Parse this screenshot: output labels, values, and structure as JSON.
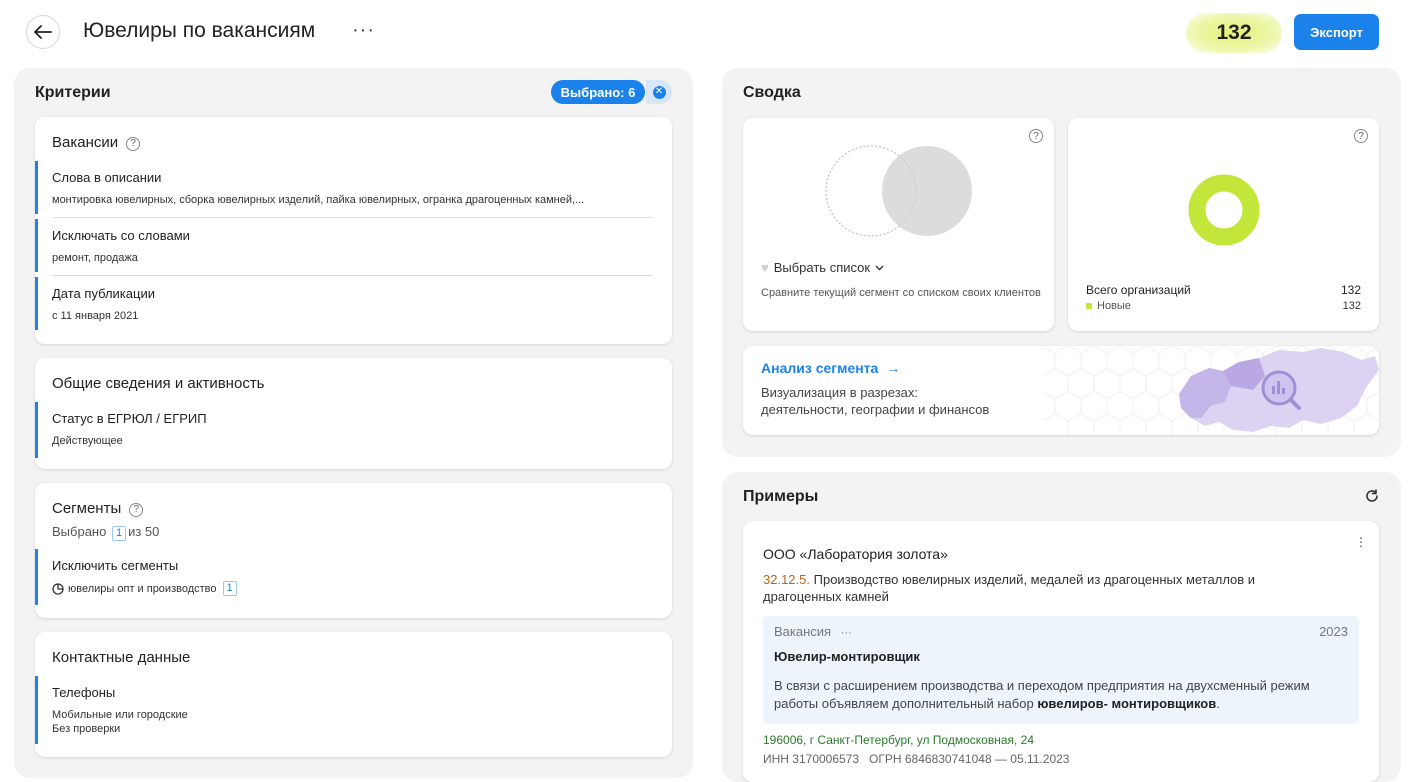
{
  "header": {
    "title": "Ювелиры по вакансиям",
    "more": "···",
    "count": "132",
    "export_label": "Экспорт"
  },
  "criteria": {
    "title": "Критерии",
    "selected_label": "Выбрано: 6",
    "vacancies": {
      "title": "Вакансии",
      "help": "?",
      "items": [
        {
          "name": "Слова в описании",
          "value": "монтировка ювелирных, сборка ювелирных изделий, пайка ювелирных, огранка драгоценных камней,..."
        },
        {
          "name": "Исключать со словами",
          "value": "ремонт, продажа"
        },
        {
          "name": "Дата публикации",
          "value": "с 11 января 2021"
        }
      ]
    },
    "general": {
      "title": "Общие сведения и активность",
      "items": [
        {
          "name": "Статус в ЕГРЮЛ / ЕГРИП",
          "value": "Действующее"
        }
      ]
    },
    "segments": {
      "title": "Сегменты",
      "help": "?",
      "selected_prefix": "Выбрано",
      "selected_count": "1",
      "selected_suffix": "из 50",
      "exclude_name": "Исключить сегменты",
      "exclude_value": "ювелиры опт и производство",
      "exclude_count": "1"
    },
    "contacts": {
      "title": "Контактные данные",
      "phones_name": "Телефоны",
      "phones_line1": "Мобильные или городские",
      "phones_line2": "Без проверки"
    }
  },
  "summary": {
    "title": "Сводка",
    "help": "?",
    "choose_list": "Выбрать список",
    "compare_hint": "Сравните текущий сегмент со списком своих клиентов",
    "total_label": "Всего организаций",
    "total_value": "132",
    "new_label": "Новые",
    "new_value": "132",
    "new_fraction": 1.0,
    "analysis_link": "Анализ сегмента",
    "analysis_line1": "Визуализация в разрезах:",
    "analysis_line2": "деятельности, географии и финансов"
  },
  "examples": {
    "title": "Примеры",
    "org_name": "ООО «Лаборатория золота»",
    "okved_code": "32.12.5.",
    "okved_text": "Производство ювелирных изделий, медалей из драгоценных металлов и драгоценных камней",
    "vacancy_label": "Вакансия",
    "vacancy_more": "···",
    "vacancy_year": "2023",
    "vacancy_title": "Ювелир-монтировщик",
    "vacancy_text": "В связи с расширением производства и переходом предприятия на двухсменный режим работы объявляем дополнительный набор",
    "vacancy_highlight": "ювелиров- монтировщиков",
    "vacancy_end": ".",
    "address": "196006, г Санкт-Петербург, ул Подмосковная, 24",
    "inn": "ИНН 3170006573   ОГРН 6846830741048 — 05.11.2023"
  },
  "colors": {
    "accent": "#1a82ea",
    "donut": "#c3e63a",
    "count_highlight": "#e3f27a"
  }
}
